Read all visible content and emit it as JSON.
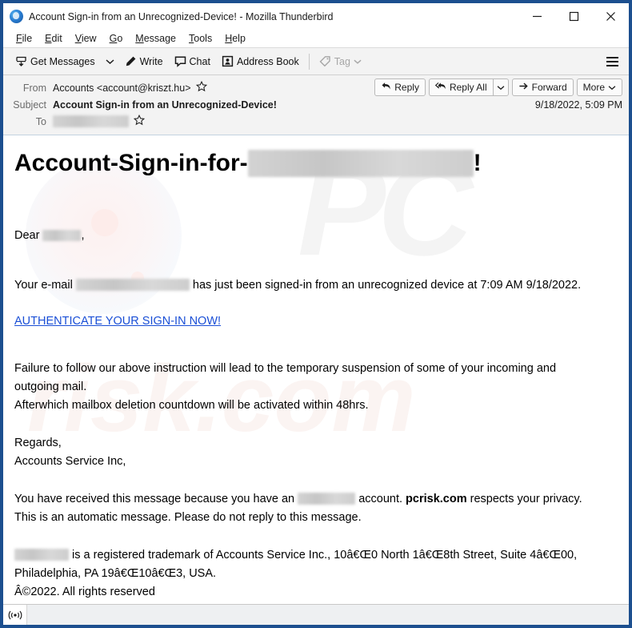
{
  "window": {
    "title": "Account Sign-in from an Unrecognized-Device! - Mozilla Thunderbird",
    "logo_icon": "thunderbird-logo-icon",
    "minimize_label": "─",
    "maximize_label": "□",
    "close_label": "✕"
  },
  "menubar": {
    "items": [
      {
        "pre": "",
        "key": "F",
        "post": "ile"
      },
      {
        "pre": "",
        "key": "E",
        "post": "dit"
      },
      {
        "pre": "",
        "key": "V",
        "post": "iew"
      },
      {
        "pre": "",
        "key": "G",
        "post": "o"
      },
      {
        "pre": "",
        "key": "M",
        "post": "essage"
      },
      {
        "pre": "",
        "key": "T",
        "post": "ools"
      },
      {
        "pre": "",
        "key": "H",
        "post": "elp"
      }
    ]
  },
  "toolbar": {
    "get_messages_label": "Get Messages",
    "get_messages_icon": "download-inbox-icon",
    "get_messages_chevron_icon": "chevron-down-icon",
    "write_label": "Write",
    "write_icon": "pencil-icon",
    "chat_label": "Chat",
    "chat_icon": "speech-bubble-icon",
    "address_book_label": "Address Book",
    "address_book_icon": "contact-card-icon",
    "tag_label": "Tag",
    "tag_icon": "tag-icon",
    "tag_chevron_icon": "chevron-down-icon",
    "app_menu_icon": "hamburger-menu-icon"
  },
  "message_header": {
    "from_label": "From",
    "from_value": "Accounts <account@kriszt.hu>",
    "from_star_icon": "star-outline-icon",
    "subject_label": "Subject",
    "subject_value": "Account Sign-in from an Unrecognized-Device!",
    "to_label": "To",
    "to_value_redacted": "",
    "to_star_icon": "star-outline-icon",
    "date": "9/18/2022, 5:09 PM",
    "actions": {
      "reply_label": "Reply",
      "reply_icon": "reply-arrow-icon",
      "reply_all_label": "Reply All",
      "reply_all_icon": "reply-all-arrow-icon",
      "reply_all_chevron_icon": "chevron-down-icon",
      "forward_label": "Forward",
      "forward_icon": "forward-arrow-icon",
      "more_label": "More",
      "more_chevron_icon": "chevron-down-icon"
    }
  },
  "email_body": {
    "title_prefix": "Account-Sign-in-for-",
    "title_suffix": "!",
    "greeting_prefix": "Dear",
    "greeting_suffix": ",",
    "line_email_prefix": "Your e-mail",
    "line_email_suffix": "has just been signed-in from an unrecognized device at 7:09 AM 9/18/2022.",
    "auth_link_text": "AUTHENTICATE YOUR SIGN-IN NOW!",
    "warning_line_1": "Failure to follow our above instruction will lead to the temporary suspension of some of your incoming and",
    "warning_line_2": "outgoing mail.",
    "warning_line_3": "Afterwhich mailbox deletion countdown will be activated within 48hrs.",
    "regards_line_1": "Regards,",
    "regards_line_2": "Accounts Service Inc,",
    "notice_prefix": "You have received this message because you have an",
    "notice_middle": "account.",
    "notice_brand": "pcrisk.com",
    "notice_suffix": "respects your privacy.",
    "notice_line_2": "This is an automatic message. Please do not reply to this message.",
    "trademark_suffix": "is a registered trademark of Accounts Service Inc., 10â€Œ0 North 1â€Œ8th Street, Suite 4â€Œ00,",
    "trademark_line_2": "Philadelphia, PA 19â€Œ10â€Œ3, USA.",
    "copyright_line": "Â©2022. All rights reserved",
    "watermark_brand": "PC",
    "watermark_domain": "risk.com"
  },
  "statusbar": {
    "icon": "broadcast-signal-icon"
  },
  "colors": {
    "window_border": "#1c4f8f",
    "toolbar_bg": "#f3f3f3",
    "link": "#1a4fd6",
    "text": "#000000",
    "label_grey": "#6b6b6b"
  }
}
